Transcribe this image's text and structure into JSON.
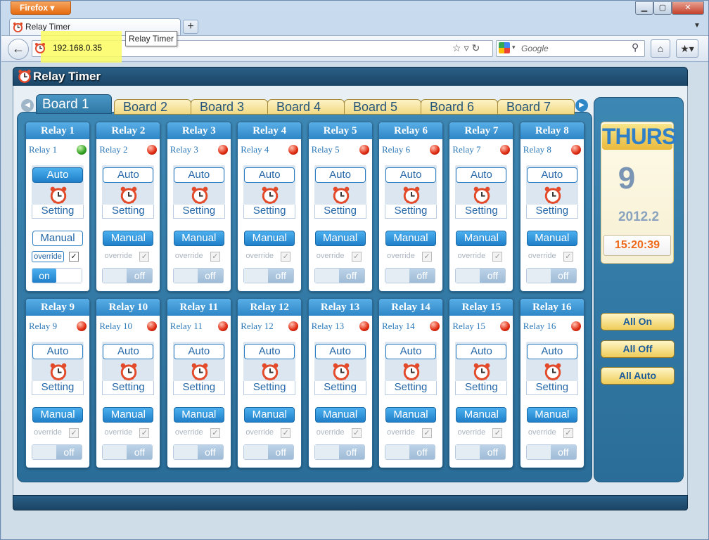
{
  "browser": {
    "menu_button": "Firefox",
    "tab_title": "Relay Timer",
    "new_tab": "+",
    "tooltip": "Relay Timer",
    "url": "192.168.0.35",
    "search_placeholder": "Google",
    "window_min": "▭",
    "window_max": "▢",
    "window_close": "✕"
  },
  "app": {
    "title": "Relay Timer",
    "boards": [
      "Board 1",
      "Board 2",
      "Board 3",
      "Board 4",
      "Board 5",
      "Board 6",
      "Board 7"
    ],
    "active_board": "Board 1",
    "labels": {
      "auto": "Auto",
      "setting": "Setting",
      "manual": "Manual",
      "override": "override",
      "on": "on",
      "off": "off",
      "check": "✓"
    },
    "relays": [
      {
        "header": "Relay 1",
        "name": "Relay 1",
        "status": "on",
        "mode": "manual"
      },
      {
        "header": "Relay 2",
        "name": "Relay 2",
        "status": "off",
        "mode": "auto"
      },
      {
        "header": "Relay 3",
        "name": "Relay 3",
        "status": "off",
        "mode": "auto"
      },
      {
        "header": "Relay 4",
        "name": "Relay 4",
        "status": "off",
        "mode": "auto"
      },
      {
        "header": "Relay 5",
        "name": "Relay 5",
        "status": "off",
        "mode": "auto"
      },
      {
        "header": "Relay 6",
        "name": "Relay 6",
        "status": "off",
        "mode": "auto"
      },
      {
        "header": "Relay 7",
        "name": "Relay 7",
        "status": "off",
        "mode": "auto"
      },
      {
        "header": "Relay 8",
        "name": "Relay 8",
        "status": "off",
        "mode": "auto"
      },
      {
        "header": "Relay 9",
        "name": "Relay 9",
        "status": "off",
        "mode": "auto"
      },
      {
        "header": "Relay 10",
        "name": "Relay 10",
        "status": "off",
        "mode": "auto"
      },
      {
        "header": "Relay 11",
        "name": "Relay 11",
        "status": "off",
        "mode": "auto"
      },
      {
        "header": "Relay 12",
        "name": "Relay 12",
        "status": "off",
        "mode": "auto"
      },
      {
        "header": "Relay 13",
        "name": "Relay 13",
        "status": "off",
        "mode": "auto"
      },
      {
        "header": "Relay 14",
        "name": "Relay 14",
        "status": "off",
        "mode": "auto"
      },
      {
        "header": "Relay 15",
        "name": "Relay 15",
        "status": "off",
        "mode": "auto"
      },
      {
        "header": "Relay 16",
        "name": "Relay 16",
        "status": "off",
        "mode": "auto"
      }
    ],
    "date": {
      "day": "THURS",
      "date": "9",
      "year_month": "2012.2",
      "time": "15:20:39"
    },
    "controls": {
      "all_on": "All On",
      "all_off": "All Off",
      "all_auto": "All Auto"
    }
  },
  "icons": [
    "alarm-clock-icon",
    "back-arrow-icon",
    "star-icon",
    "reload-icon",
    "search-icon",
    "home-icon",
    "bookmark-icon",
    "left-arrow-icon",
    "right-arrow-icon"
  ],
  "colors": {
    "led_on": "#30a020",
    "led_off": "#e02a10",
    "header_blue": "#2f86c6",
    "panel": "#2a6d98",
    "accent_orange": "#ee6a1a"
  }
}
